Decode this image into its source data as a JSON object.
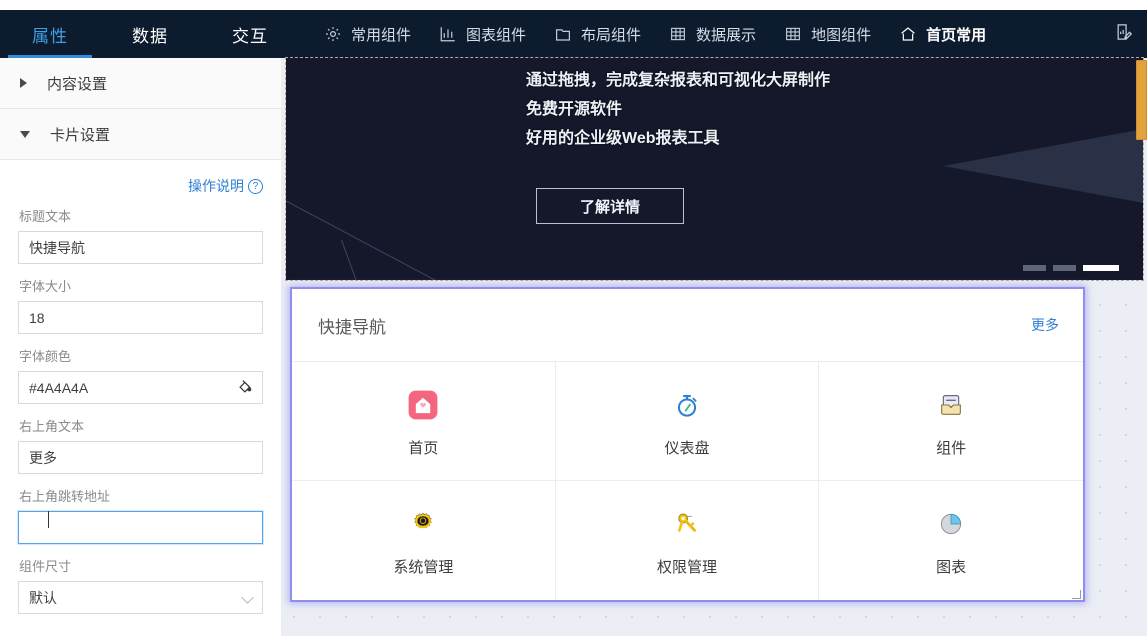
{
  "topbar": {
    "tabs": [
      {
        "label": "属性",
        "active": true
      },
      {
        "label": "数据",
        "active": false
      },
      {
        "label": "交互",
        "active": false
      }
    ],
    "nav": [
      {
        "label": "常用组件",
        "icon": "gear-icon"
      },
      {
        "label": "图表组件",
        "icon": "bar-chart-icon"
      },
      {
        "label": "布局组件",
        "icon": "layout-icon"
      },
      {
        "label": "数据展示",
        "icon": "table-icon"
      },
      {
        "label": "地图组件",
        "icon": "grid-map-icon"
      },
      {
        "label": "首页常用",
        "icon": "home-icon"
      }
    ],
    "right_icon": "page-edit-icon",
    "accent": "#3d9fe8",
    "background": "#0d1b2e"
  },
  "left_panel": {
    "sections": [
      {
        "title": "内容设置",
        "expanded": false
      },
      {
        "title": "卡片设置",
        "expanded": true
      }
    ],
    "help_link": "操作说明",
    "help_icon": "question-circle-icon",
    "fields": [
      {
        "label": "标题文本",
        "value": "快捷导航",
        "type": "text"
      },
      {
        "label": "字体大小",
        "value": "18",
        "type": "text"
      },
      {
        "label": "字体颜色",
        "value": "#4A4A4A",
        "type": "color",
        "icon": "color-fill-icon"
      },
      {
        "label": "右上角文本",
        "value": "更多",
        "type": "text"
      },
      {
        "label": "右上角跳转地址",
        "value": "",
        "type": "text",
        "focused": true
      },
      {
        "label": "组件尺寸",
        "value": "默认",
        "type": "select",
        "icon": "chevron-down-icon"
      }
    ]
  },
  "canvas": {
    "banner": {
      "lines": [
        "通过拖拽，完成复杂报表和可视化大屏制作",
        "免费开源软件",
        "好用的企业级Web报表工具"
      ],
      "button": "了解详情",
      "carousel": {
        "total": 3,
        "active_index": 2
      },
      "background": "#14182a"
    },
    "scrollbar_color": "#e2a33c",
    "card": {
      "title": "快捷导航",
      "more": "更多",
      "selection_color": "#8e8ef0",
      "items": [
        {
          "label": "首页",
          "icon": "home-app-icon"
        },
        {
          "label": "仪表盘",
          "icon": "stopwatch-icon"
        },
        {
          "label": "组件",
          "icon": "inbox-icon"
        },
        {
          "label": "系统管理",
          "icon": "gear-icon"
        },
        {
          "label": "权限管理",
          "icon": "key-icon"
        },
        {
          "label": "图表",
          "icon": "pie-chart-icon"
        }
      ]
    }
  }
}
